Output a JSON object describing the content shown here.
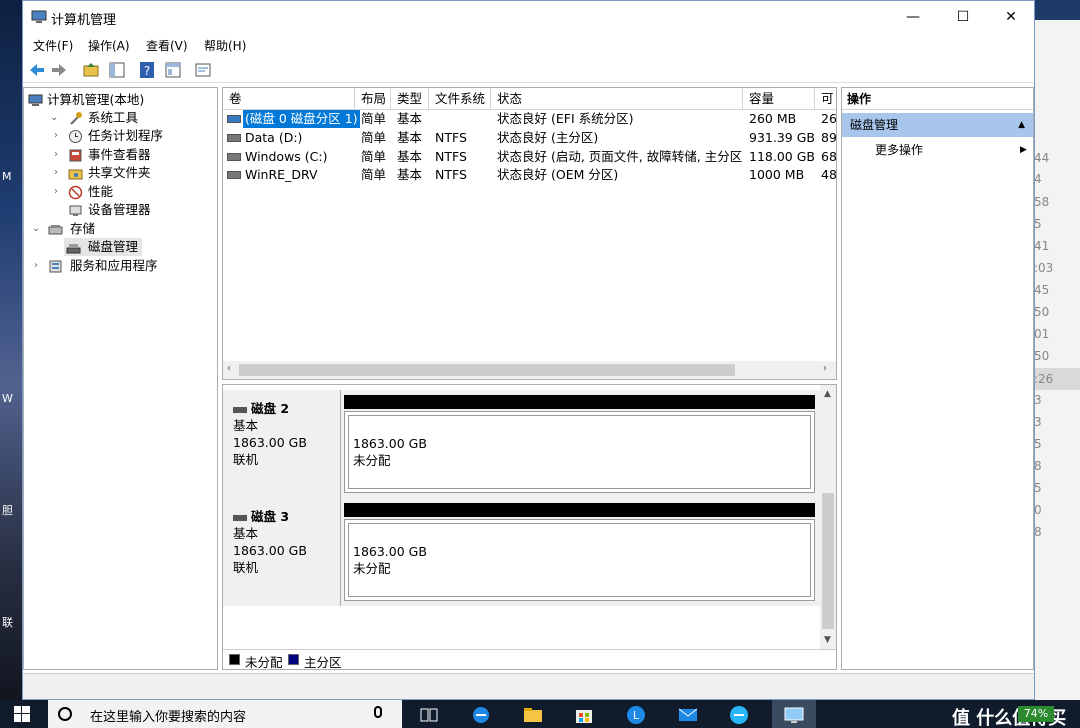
{
  "window": {
    "title": "计算机管理",
    "controls": {
      "minimize": "—",
      "maximize": "☐",
      "close": "✕"
    }
  },
  "menu": [
    "文件(F)",
    "操作(A)",
    "查看(V)",
    "帮助(H)"
  ],
  "toolbar_icons": [
    "back-arrow-icon",
    "forward-arrow-icon",
    "up-folder-icon",
    "show-hide-tree-icon",
    "help-icon",
    "properties-icon",
    "console-icon"
  ],
  "tree": {
    "root": "计算机管理(本地)",
    "system_tools": "系统工具",
    "task_scheduler": "任务计划程序",
    "event_viewer": "事件查看器",
    "shared_folders": "共享文件夹",
    "performance": "性能",
    "device_manager": "设备管理器",
    "storage": "存储",
    "disk_management": "磁盘管理",
    "services_apps": "服务和应用程序"
  },
  "volumes": {
    "columns": [
      "卷",
      "布局",
      "类型",
      "文件系统",
      "状态",
      "容量",
      "可"
    ],
    "rows": [
      {
        "vol": "(磁盘 0 磁盘分区 1)",
        "layout": "简单",
        "type": "基本",
        "fs": "",
        "status": "状态良好 (EFI 系统分区)",
        "capacity": "260 MB",
        "free": "26"
      },
      {
        "vol": "Data (D:)",
        "layout": "简单",
        "type": "基本",
        "fs": "NTFS",
        "status": "状态良好 (主分区)",
        "capacity": "931.39 GB",
        "free": "89"
      },
      {
        "vol": "Windows (C:)",
        "layout": "简单",
        "type": "基本",
        "fs": "NTFS",
        "status": "状态良好 (启动, 页面文件, 故障转储, 主分区)",
        "capacity": "118.00 GB",
        "free": "68"
      },
      {
        "vol": "WinRE_DRV",
        "layout": "简单",
        "type": "基本",
        "fs": "NTFS",
        "status": "状态良好 (OEM 分区)",
        "capacity": "1000 MB",
        "free": "48"
      }
    ]
  },
  "disks": [
    {
      "name": "磁盘 2",
      "type": "基本",
      "size": "1863.00 GB",
      "status": "联机",
      "part_size": "1863.00 GB",
      "part_state": "未分配"
    },
    {
      "name": "磁盘 3",
      "type": "基本",
      "size": "1863.00 GB",
      "status": "联机",
      "part_size": "1863.00 GB",
      "part_state": "未分配"
    }
  ],
  "legend": {
    "unallocated": "未分配",
    "primary": "主分区",
    "colors": {
      "unallocated": "#000000",
      "primary": "#000080"
    }
  },
  "actions": {
    "header": "操作",
    "section": "磁盘管理",
    "more": "更多操作"
  },
  "desktop_right_numbers": [
    "44",
    "4",
    "58",
    "5",
    "41",
    ":03",
    "45",
    "50",
    "01",
    "50",
    ":26",
    "3",
    "3",
    "5",
    "8",
    "5",
    "0",
    "8"
  ],
  "desktop_left_glyphs": [
    "M",
    "W",
    "胆",
    "联"
  ],
  "taskbar": {
    "search_placeholder": "在这里输入你要搜索的内容",
    "battery": "74%",
    "brand": "值 什么值得买"
  },
  "colors": {
    "selection": "#0078d7",
    "action_section": "#a8c6ec",
    "unallocated_bar": "#000000"
  }
}
